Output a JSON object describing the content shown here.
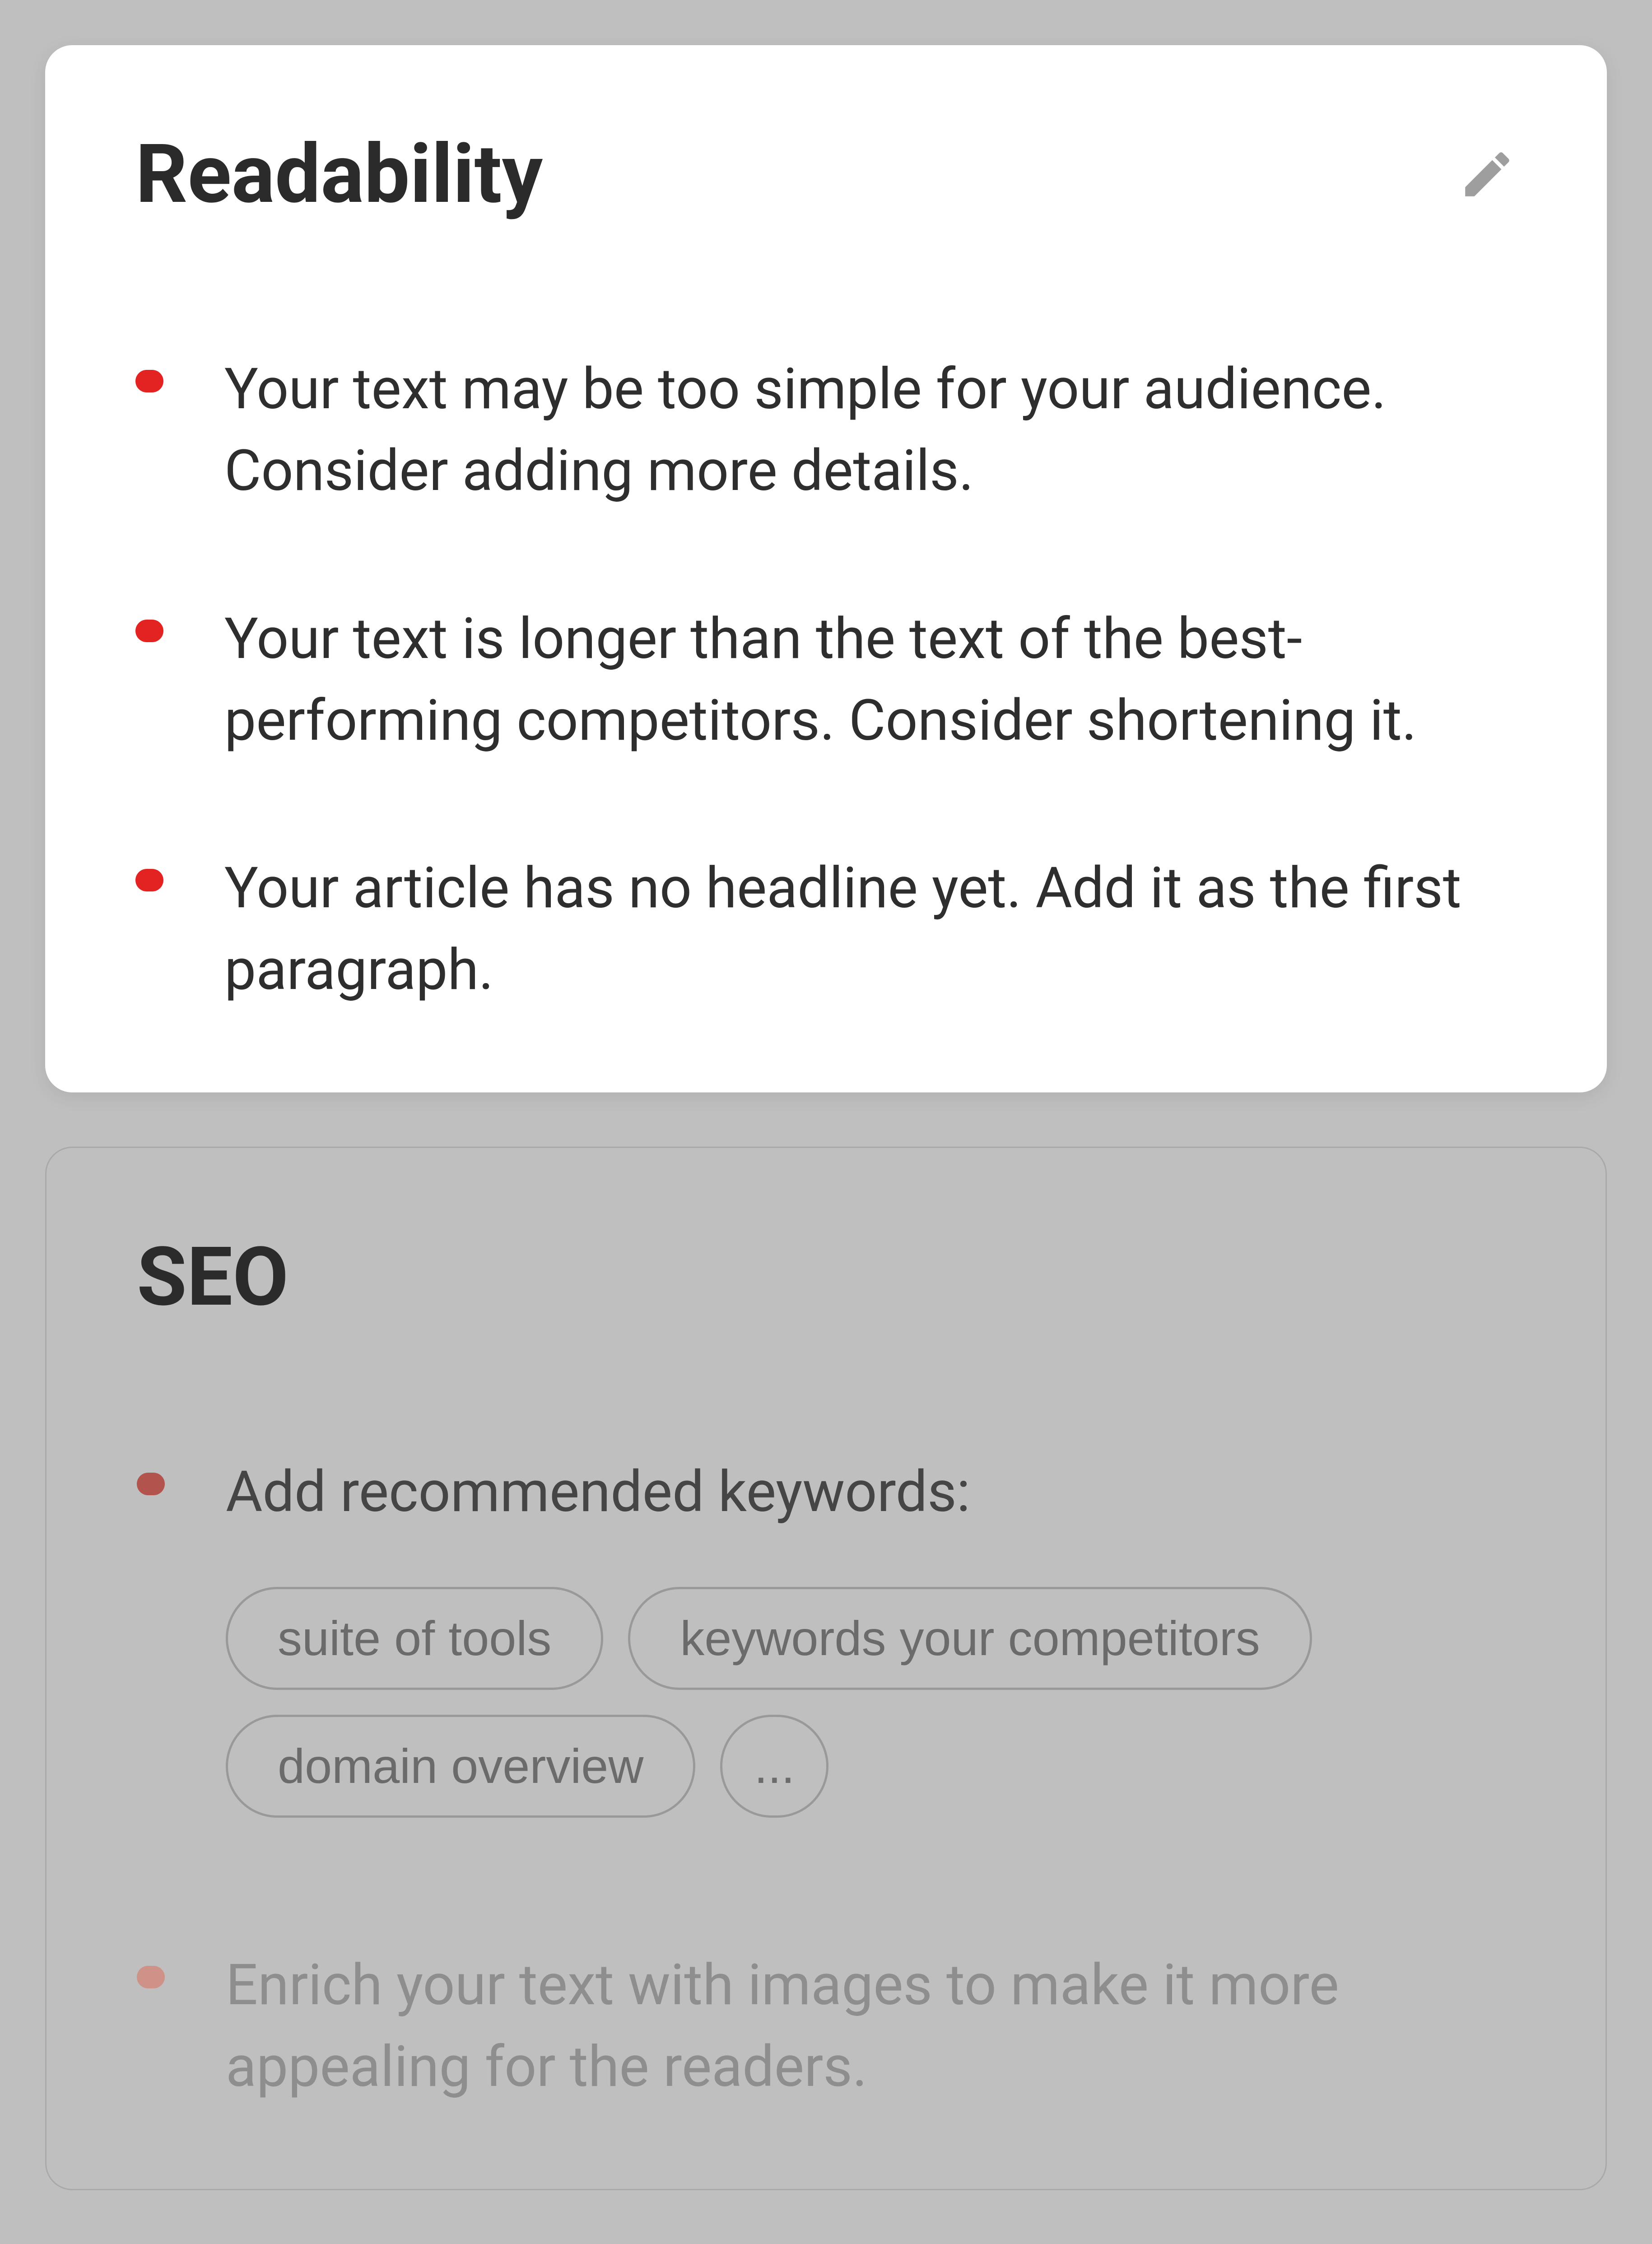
{
  "readability": {
    "title": "Readability",
    "items": [
      "Your text may be too simple for your audience. Consider adding more details.",
      "Your text is longer than the text of the best-performing competitors. Consider shortening it.",
      "Your article has no headline yet. Add it as the first paragraph."
    ]
  },
  "seo": {
    "title": "SEO",
    "item1": "Add recommended keywords:",
    "keywords": {
      "k1": "suite of tools",
      "k2": "keywords your competitors",
      "k3": "domain overview",
      "more": "..."
    },
    "item2": "Enrich your text with images to make it more appealing for the readers."
  },
  "colors": {
    "bullet_red": "#e32321",
    "background": "#bfbfbf"
  }
}
